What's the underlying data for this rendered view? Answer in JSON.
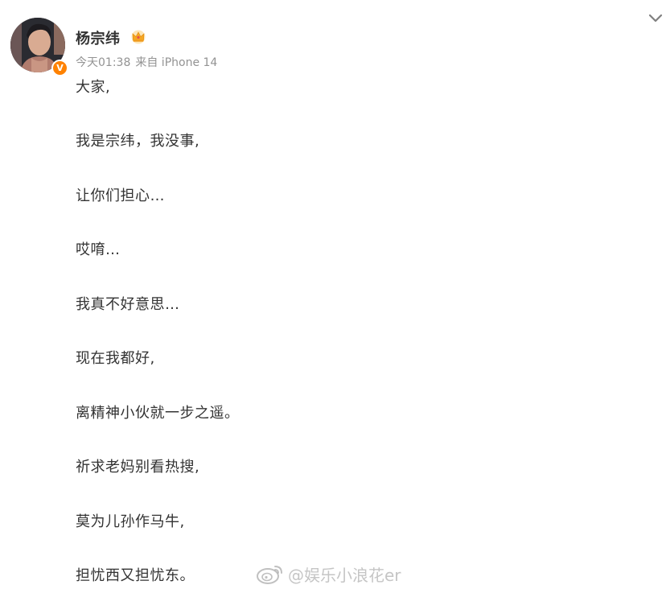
{
  "post": {
    "author": {
      "name": "杨宗纬",
      "verified_badge": "V",
      "badge_icon": "crown-icon",
      "avatar_icon": "avatar"
    },
    "meta": {
      "time": "今天01:38",
      "source": "来自 iPhone 14"
    },
    "menu_icon": "chevron-down-icon",
    "lines": [
      "大家,",
      "我是宗纬，我没事,",
      "让你们担心…",
      "哎唷…",
      "我真不好意思…",
      "现在我都好,",
      "离精神小伙就一步之遥。",
      "祈求老妈别看热搜,",
      "莫为儿孙作马牛,",
      "担忧西又担忧东。"
    ]
  },
  "watermark": {
    "text": "@娱乐小浪花er",
    "icon": "weibo-logo-icon"
  },
  "colors": {
    "text": "#333333",
    "meta": "#939393",
    "verified": "#ff8200",
    "crown": "#f5a623"
  }
}
